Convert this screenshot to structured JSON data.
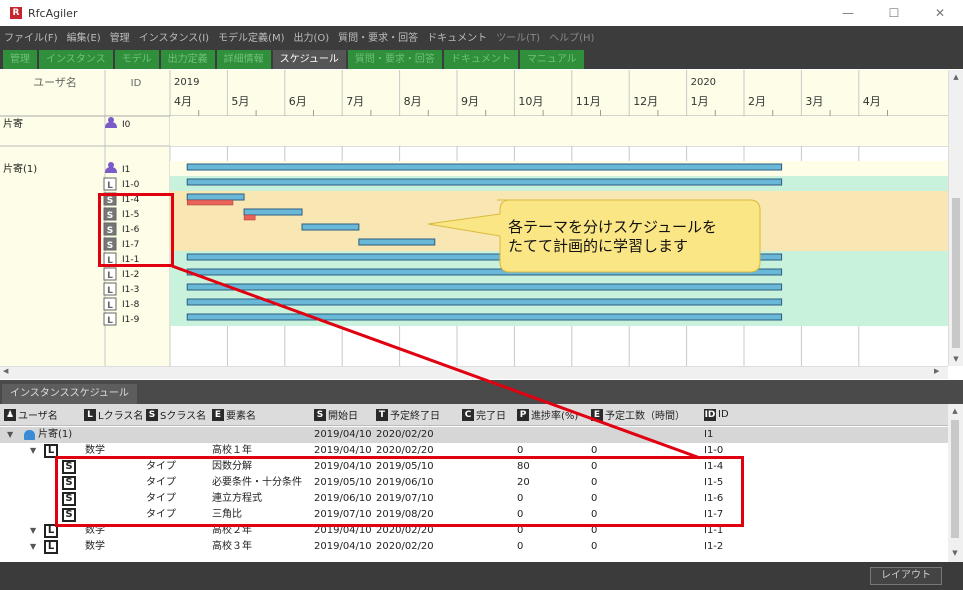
{
  "window": {
    "app_title": "RfcAgiler",
    "logo_letter": "R",
    "minimize": "—",
    "maximize": "☐",
    "close": "✕"
  },
  "menu": [
    "ファイル(F)",
    "編集(E)",
    "管理",
    "インスタンス(I)",
    "モデル定義(M)",
    "出力(O)",
    "質問・要求・回答",
    "ドキュメント",
    "ツール(T)",
    "ヘルプ(H)"
  ],
  "tabs": [
    {
      "label": "管理",
      "active": false
    },
    {
      "label": "インスタンス",
      "active": false
    },
    {
      "label": "モデル",
      "active": false
    },
    {
      "label": "出力定義",
      "active": false
    },
    {
      "label": "詳細情報",
      "active": false
    },
    {
      "label": "スケジュール",
      "active": true
    },
    {
      "label": "質問・要求・回答",
      "active": false
    },
    {
      "label": "ドキュメント",
      "active": false
    },
    {
      "label": "マニュアル",
      "active": false
    }
  ],
  "gantt": {
    "col_user": "ユーザ名",
    "col_id": "ID",
    "years": [
      {
        "label": "2019",
        "month_index": 0
      },
      {
        "label": "2020",
        "month_index": 9
      }
    ],
    "months": [
      "4月",
      "5月",
      "6月",
      "7月",
      "8月",
      "9月",
      "10月",
      "11月",
      "12月",
      "1月",
      "2月",
      "3月",
      "4月"
    ],
    "rows": [
      {
        "user": "片寄",
        "type": "U",
        "id": "I0",
        "bg": "#fdfde8",
        "bars": []
      },
      {
        "user": "",
        "type": "",
        "id": "",
        "bg": "#fdfde8",
        "bars": []
      },
      {
        "user": "片寄(1)",
        "type": "U",
        "id": "I1",
        "bg": "#fdfde8",
        "bars": [
          {
            "start": "2019-04-10",
            "end": "2020-02-20",
            "kind": "plan"
          }
        ]
      },
      {
        "user": "",
        "type": "L",
        "id": "I1-0",
        "bg": "#c9f2dd",
        "bars": [
          {
            "start": "2019-04-10",
            "end": "2020-02-20",
            "kind": "plan"
          }
        ]
      },
      {
        "user": "",
        "type": "S",
        "id": "I1-4",
        "bg": "#f8e7b3",
        "bars": [
          {
            "start": "2019-04-10",
            "end": "2019-05-10",
            "kind": "plan"
          },
          {
            "start": "2019-04-10",
            "end": "2019-05-04",
            "kind": "progress"
          }
        ]
      },
      {
        "user": "",
        "type": "S",
        "id": "I1-5",
        "bg": "#f8e7b3",
        "bars": [
          {
            "start": "2019-05-10",
            "end": "2019-06-10",
            "kind": "plan"
          },
          {
            "start": "2019-05-10",
            "end": "2019-05-16",
            "kind": "progress"
          }
        ]
      },
      {
        "user": "",
        "type": "S",
        "id": "I1-6",
        "bg": "#f8e7b3",
        "bars": [
          {
            "start": "2019-06-10",
            "end": "2019-07-10",
            "kind": "plan"
          }
        ]
      },
      {
        "user": "",
        "type": "S",
        "id": "I1-7",
        "bg": "#f8e7b3",
        "bars": [
          {
            "start": "2019-07-10",
            "end": "2019-08-20",
            "kind": "plan"
          }
        ]
      },
      {
        "user": "",
        "type": "L",
        "id": "I1-1",
        "bg": "#c9f2dd",
        "bars": [
          {
            "start": "2019-04-10",
            "end": "2020-02-20",
            "kind": "plan"
          }
        ]
      },
      {
        "user": "",
        "type": "L",
        "id": "I1-2",
        "bg": "#c9f2dd",
        "bars": [
          {
            "start": "2019-04-10",
            "end": "2020-02-20",
            "kind": "plan"
          }
        ]
      },
      {
        "user": "",
        "type": "L",
        "id": "I1-3",
        "bg": "#c9f2dd",
        "bars": [
          {
            "start": "2019-04-10",
            "end": "2020-02-20",
            "kind": "plan"
          }
        ]
      },
      {
        "user": "",
        "type": "L",
        "id": "I1-8",
        "bg": "#c9f2dd",
        "bars": [
          {
            "start": "2019-04-10",
            "end": "2020-02-20",
            "kind": "plan"
          }
        ]
      },
      {
        "user": "",
        "type": "L",
        "id": "I1-9",
        "bg": "#c9f2dd",
        "bars": [
          {
            "start": "2019-04-10",
            "end": "2020-02-20",
            "kind": "plan"
          }
        ]
      }
    ]
  },
  "callout_text": "各テーマを分けスケジュールを\nたてて計画的に学習します",
  "panel": {
    "tab_label": "インスタンススケジュール"
  },
  "columns": [
    {
      "badge": "U",
      "label": "ユーザ名"
    },
    {
      "badge": "L",
      "label": "Lクラス名"
    },
    {
      "badge": "S",
      "label": "Sクラス名"
    },
    {
      "badge": "E",
      "label": "要素名"
    },
    {
      "badge": "S",
      "label": "開始日"
    },
    {
      "badge": "T",
      "label": "予定終了日"
    },
    {
      "badge": "C",
      "label": "完了日"
    },
    {
      "badge": "P",
      "label": "進捗率(%)"
    },
    {
      "badge": "E",
      "label": "予定工数（時間）"
    },
    {
      "badge": "ID",
      "label": "ID"
    }
  ],
  "table_rows": [
    {
      "level": 0,
      "type": "U",
      "user": "片寄(1)",
      "lclass": "",
      "sclass": "",
      "element": "",
      "start": "2019/04/10",
      "end": "2020/02/20",
      "done": "",
      "progress": "",
      "effort": "",
      "id": "I1",
      "selected": true
    },
    {
      "level": 1,
      "type": "L",
      "user": "",
      "lclass": "数学",
      "sclass": "",
      "element": "高校１年",
      "start": "2019/04/10",
      "end": "2020/02/20",
      "done": "",
      "progress": "0",
      "effort": "0",
      "id": "I1-0",
      "selected": false
    },
    {
      "level": 2,
      "type": "S",
      "user": "",
      "lclass": "",
      "sclass": "タイプ",
      "element": "因数分解",
      "start": "2019/04/10",
      "end": "2019/05/10",
      "done": "",
      "progress": "80",
      "effort": "0",
      "id": "I1-4",
      "selected": false
    },
    {
      "level": 2,
      "type": "S",
      "user": "",
      "lclass": "",
      "sclass": "タイプ",
      "element": "必要条件・十分条件",
      "start": "2019/05/10",
      "end": "2019/06/10",
      "done": "",
      "progress": "20",
      "effort": "0",
      "id": "I1-5",
      "selected": false
    },
    {
      "level": 2,
      "type": "S",
      "user": "",
      "lclass": "",
      "sclass": "タイプ",
      "element": "連立方程式",
      "start": "2019/06/10",
      "end": "2019/07/10",
      "done": "",
      "progress": "0",
      "effort": "0",
      "id": "I1-6",
      "selected": false
    },
    {
      "level": 2,
      "type": "S",
      "user": "",
      "lclass": "",
      "sclass": "タイプ",
      "element": "三角比",
      "start": "2019/07/10",
      "end": "2019/08/20",
      "done": "",
      "progress": "0",
      "effort": "0",
      "id": "I1-7",
      "selected": false
    },
    {
      "level": 1,
      "type": "L",
      "user": "",
      "lclass": "数学",
      "sclass": "",
      "element": "高校２年",
      "start": "2019/04/10",
      "end": "2020/02/20",
      "done": "",
      "progress": "0",
      "effort": "0",
      "id": "I1-1",
      "selected": false
    },
    {
      "level": 1,
      "type": "L",
      "user": "",
      "lclass": "数学",
      "sclass": "",
      "element": "高校３年",
      "start": "2019/04/10",
      "end": "2020/02/20",
      "done": "",
      "progress": "0",
      "effort": "0",
      "id": "I1-2",
      "selected": false
    }
  ],
  "status": {
    "layout_button": "レイアウト"
  },
  "colors": {
    "plan_bar": "#6ab8d8",
    "progress_bar": "#e8635a",
    "highlight": "#e00010",
    "callout_fill": "#fbe685",
    "tab_green": "#2f8f3a"
  }
}
